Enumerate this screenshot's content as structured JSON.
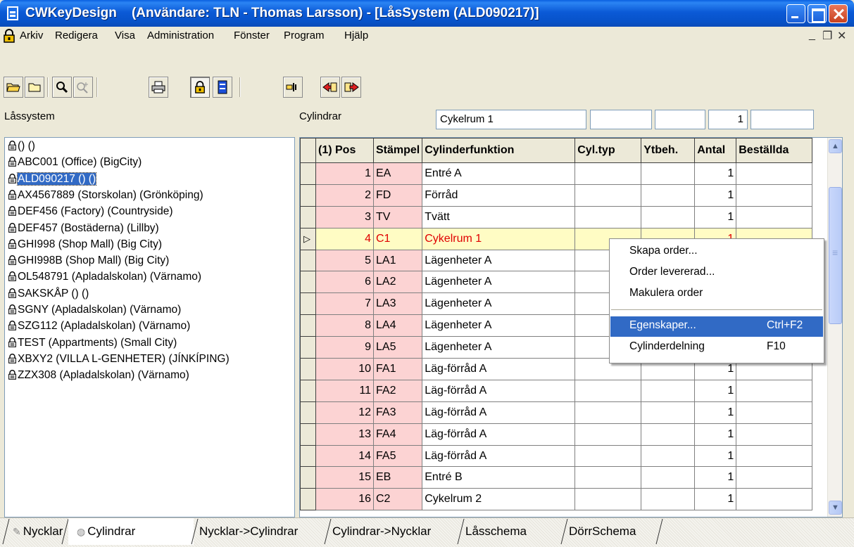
{
  "window": {
    "title": "CWKeyDesign    (Användare: TLN - Thomas Larsson) - [LåsSystem (ALD090217)]"
  },
  "menu": {
    "items": [
      "Arkiv",
      "Redigera",
      "Visa",
      "Administration",
      "Fönster",
      "Program",
      "Hjälp"
    ]
  },
  "toolbar": {
    "buttons": [
      "open-folder-icon",
      "folder-icon",
      "search-icon",
      "search-plus-icon",
      "printer-icon",
      "lock-icon",
      "database-icon",
      "key-arrow-icon",
      "export-icon",
      "import-icon"
    ]
  },
  "header": {
    "left_label": "Låssystem",
    "right_label": "Cylindrar",
    "field1": "Cykelrum 1",
    "field2": "",
    "field3": "",
    "field4": "1",
    "field5": ""
  },
  "tree": {
    "items": [
      "() ()",
      "ABC001 (Office) (BigCity)",
      "ALD090217 () ()",
      "AX4567889 (Storskolan) (Grönköping)",
      "DEF456 (Factory) (Countryside)",
      "DEF457 (Bostäderna) (Lillby)",
      "GHI998 (Shop Mall) (Big City)",
      "GHI998B (Shop Mall) (Big City)",
      "OL548791 (Apladalskolan) (Värnamo)",
      "SAKSKÅP () ()",
      "SGNY (Apladalskolan) (Värnamo)",
      "SZG112 (Apladalskolan) (Värnamo)",
      "TEST (Appartments) (Small City)",
      "XBXY2 (VILLA L-GENHETER) (JÍNKÍPING)",
      "ZZX308 (Apladalskolan) (Värnamo)"
    ],
    "selected_index": 2
  },
  "grid": {
    "headers": [
      "(1) Pos",
      "Stämpel",
      "Cylinderfunktion",
      "Cyl.typ",
      "Ytbeh.",
      "Antal",
      "Beställda"
    ],
    "rows": [
      {
        "pos": "1",
        "stamp": "EA",
        "func": "Entré A",
        "typ": "",
        "ytbeh": "",
        "antal": "1",
        "best": ""
      },
      {
        "pos": "2",
        "stamp": "FD",
        "func": "Förråd",
        "typ": "",
        "ytbeh": "",
        "antal": "1",
        "best": ""
      },
      {
        "pos": "3",
        "stamp": "TV",
        "func": "Tvätt",
        "typ": "",
        "ytbeh": "",
        "antal": "1",
        "best": ""
      },
      {
        "pos": "4",
        "stamp": "C1",
        "func": "Cykelrum 1",
        "typ": "",
        "ytbeh": "",
        "antal": "1",
        "best": ""
      },
      {
        "pos": "5",
        "stamp": "LA1",
        "func": "Lägenheter A",
        "typ": "",
        "ytbeh": "",
        "antal": "",
        "best": ""
      },
      {
        "pos": "6",
        "stamp": "LA2",
        "func": "Lägenheter A",
        "typ": "",
        "ytbeh": "",
        "antal": "",
        "best": ""
      },
      {
        "pos": "7",
        "stamp": "LA3",
        "func": "Lägenheter A",
        "typ": "",
        "ytbeh": "",
        "antal": "",
        "best": ""
      },
      {
        "pos": "8",
        "stamp": "LA4",
        "func": "Lägenheter A",
        "typ": "",
        "ytbeh": "",
        "antal": "",
        "best": ""
      },
      {
        "pos": "9",
        "stamp": "LA5",
        "func": "Lägenheter A",
        "typ": "",
        "ytbeh": "",
        "antal": "",
        "best": ""
      },
      {
        "pos": "10",
        "stamp": "FA1",
        "func": "Läg-förråd A",
        "typ": "",
        "ytbeh": "",
        "antal": "1",
        "best": ""
      },
      {
        "pos": "11",
        "stamp": "FA2",
        "func": "Läg-förråd A",
        "typ": "",
        "ytbeh": "",
        "antal": "1",
        "best": ""
      },
      {
        "pos": "12",
        "stamp": "FA3",
        "func": "Läg-förråd A",
        "typ": "",
        "ytbeh": "",
        "antal": "1",
        "best": ""
      },
      {
        "pos": "13",
        "stamp": "FA4",
        "func": "Läg-förråd A",
        "typ": "",
        "ytbeh": "",
        "antal": "1",
        "best": ""
      },
      {
        "pos": "14",
        "stamp": "FA5",
        "func": "Läg-förråd A",
        "typ": "",
        "ytbeh": "",
        "antal": "1",
        "best": ""
      },
      {
        "pos": "15",
        "stamp": "EB",
        "func": "Entré B",
        "typ": "",
        "ytbeh": "",
        "antal": "1",
        "best": ""
      },
      {
        "pos": "16",
        "stamp": "C2",
        "func": "Cykelrum 2",
        "typ": "",
        "ytbeh": "",
        "antal": "1",
        "best": ""
      }
    ],
    "current_row": 3
  },
  "context_menu": {
    "items": [
      {
        "label": "Skapa order...",
        "shortcut": ""
      },
      {
        "label": "Order levererad...",
        "shortcut": ""
      },
      {
        "label": "Makulera order",
        "shortcut": ""
      },
      {
        "label": "Egenskaper...",
        "shortcut": "Ctrl+F2"
      },
      {
        "label": "Cylinderdelning",
        "shortcut": "F10"
      }
    ],
    "highlighted_index": 3
  },
  "tabs": {
    "items": [
      "Nycklar",
      "Cylindrar",
      "Nycklar->Cylindrar",
      "Cylindrar->Nycklar",
      "Låsschema",
      "DörrSchema"
    ],
    "active_index": 1
  },
  "colors": {
    "title_blue": "#0752c9",
    "selection": "#316ac5",
    "pink_cell": "#fcd3d3",
    "current_row": "#fffcc4",
    "current_text": "#e00000"
  }
}
